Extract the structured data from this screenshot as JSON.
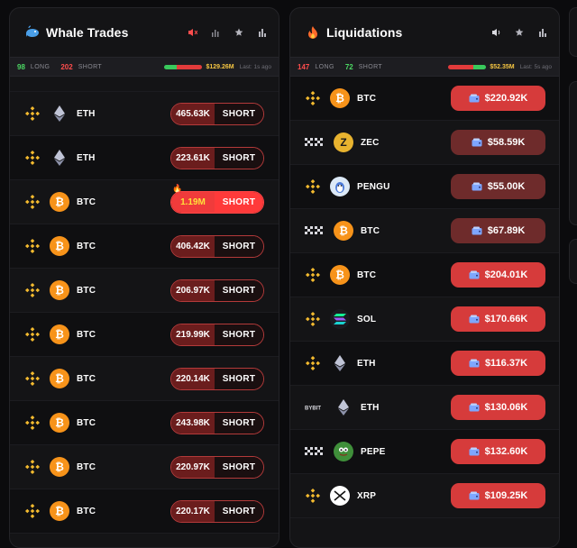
{
  "whale": {
    "title": "Whale Trades",
    "stats": {
      "long_count": "98",
      "long_label": "LONG",
      "short_count": "202",
      "short_label": "SHORT",
      "total": "$129.26M",
      "last": "Last: 1s ago",
      "long_ratio": 0.33
    },
    "controls": [
      "mute-icon",
      "bars-icon",
      "star-icon",
      "chart-icon"
    ],
    "rows": [
      {
        "exchange": "binance",
        "coin": "eth",
        "symbol": "ETH",
        "amount": "465.63K",
        "side": "SHORT",
        "hot": false
      },
      {
        "exchange": "binance",
        "coin": "eth",
        "symbol": "ETH",
        "amount": "223.61K",
        "side": "SHORT",
        "hot": false
      },
      {
        "exchange": "binance",
        "coin": "btc",
        "symbol": "BTC",
        "amount": "1.19M",
        "side": "SHORT",
        "hot": true
      },
      {
        "exchange": "binance",
        "coin": "btc",
        "symbol": "BTC",
        "amount": "406.42K",
        "side": "SHORT",
        "hot": false
      },
      {
        "exchange": "binance",
        "coin": "btc",
        "symbol": "BTC",
        "amount": "206.97K",
        "side": "SHORT",
        "hot": false
      },
      {
        "exchange": "binance",
        "coin": "btc",
        "symbol": "BTC",
        "amount": "219.99K",
        "side": "SHORT",
        "hot": false
      },
      {
        "exchange": "binance",
        "coin": "btc",
        "symbol": "BTC",
        "amount": "220.14K",
        "side": "SHORT",
        "hot": false
      },
      {
        "exchange": "binance",
        "coin": "btc",
        "symbol": "BTC",
        "amount": "243.98K",
        "side": "SHORT",
        "hot": false
      },
      {
        "exchange": "binance",
        "coin": "btc",
        "symbol": "BTC",
        "amount": "220.97K",
        "side": "SHORT",
        "hot": false
      },
      {
        "exchange": "binance",
        "coin": "btc",
        "symbol": "BTC",
        "amount": "220.17K",
        "side": "SHORT",
        "hot": false
      }
    ]
  },
  "liq": {
    "title": "Liquidations",
    "stats": {
      "long_count": "147",
      "long_label": "LONG",
      "short_count": "72",
      "short_label": "SHORT",
      "total": "$52.35M",
      "last": "Last: 5s ago",
      "long_ratio": 0.67
    },
    "controls": [
      "speaker-icon",
      "star-icon",
      "chart-icon"
    ],
    "rows": [
      {
        "exchange": "binance",
        "coin": "btc",
        "symbol": "BTC",
        "amount": "$220.92K",
        "strength": "strong"
      },
      {
        "exchange": "okx",
        "coin": "zec",
        "symbol": "ZEC",
        "amount": "$58.59K",
        "strength": "mid"
      },
      {
        "exchange": "binance",
        "coin": "pengu",
        "symbol": "PENGU",
        "amount": "$55.00K",
        "strength": "mid"
      },
      {
        "exchange": "okx",
        "coin": "btc",
        "symbol": "BTC",
        "amount": "$67.89K",
        "strength": "mid"
      },
      {
        "exchange": "binance",
        "coin": "btc",
        "symbol": "BTC",
        "amount": "$204.01K",
        "strength": "strong"
      },
      {
        "exchange": "binance",
        "coin": "sol",
        "symbol": "SOL",
        "amount": "$170.66K",
        "strength": "strong"
      },
      {
        "exchange": "binance",
        "coin": "eth",
        "symbol": "ETH",
        "amount": "$116.37K",
        "strength": "strong"
      },
      {
        "exchange": "bybit",
        "coin": "eth",
        "symbol": "ETH",
        "amount": "$130.06K",
        "strength": "strong"
      },
      {
        "exchange": "okx",
        "coin": "pepe",
        "symbol": "PEPE",
        "amount": "$132.60K",
        "strength": "strong"
      },
      {
        "exchange": "binance",
        "coin": "xrp",
        "symbol": "XRP",
        "amount": "$109.25K",
        "strength": "strong"
      }
    ]
  },
  "colors": {
    "long": "#4cd964",
    "short": "#ff4d4d",
    "total": "#f5c542",
    "binance": "#f3ba2f",
    "btc": "#f7931a"
  }
}
